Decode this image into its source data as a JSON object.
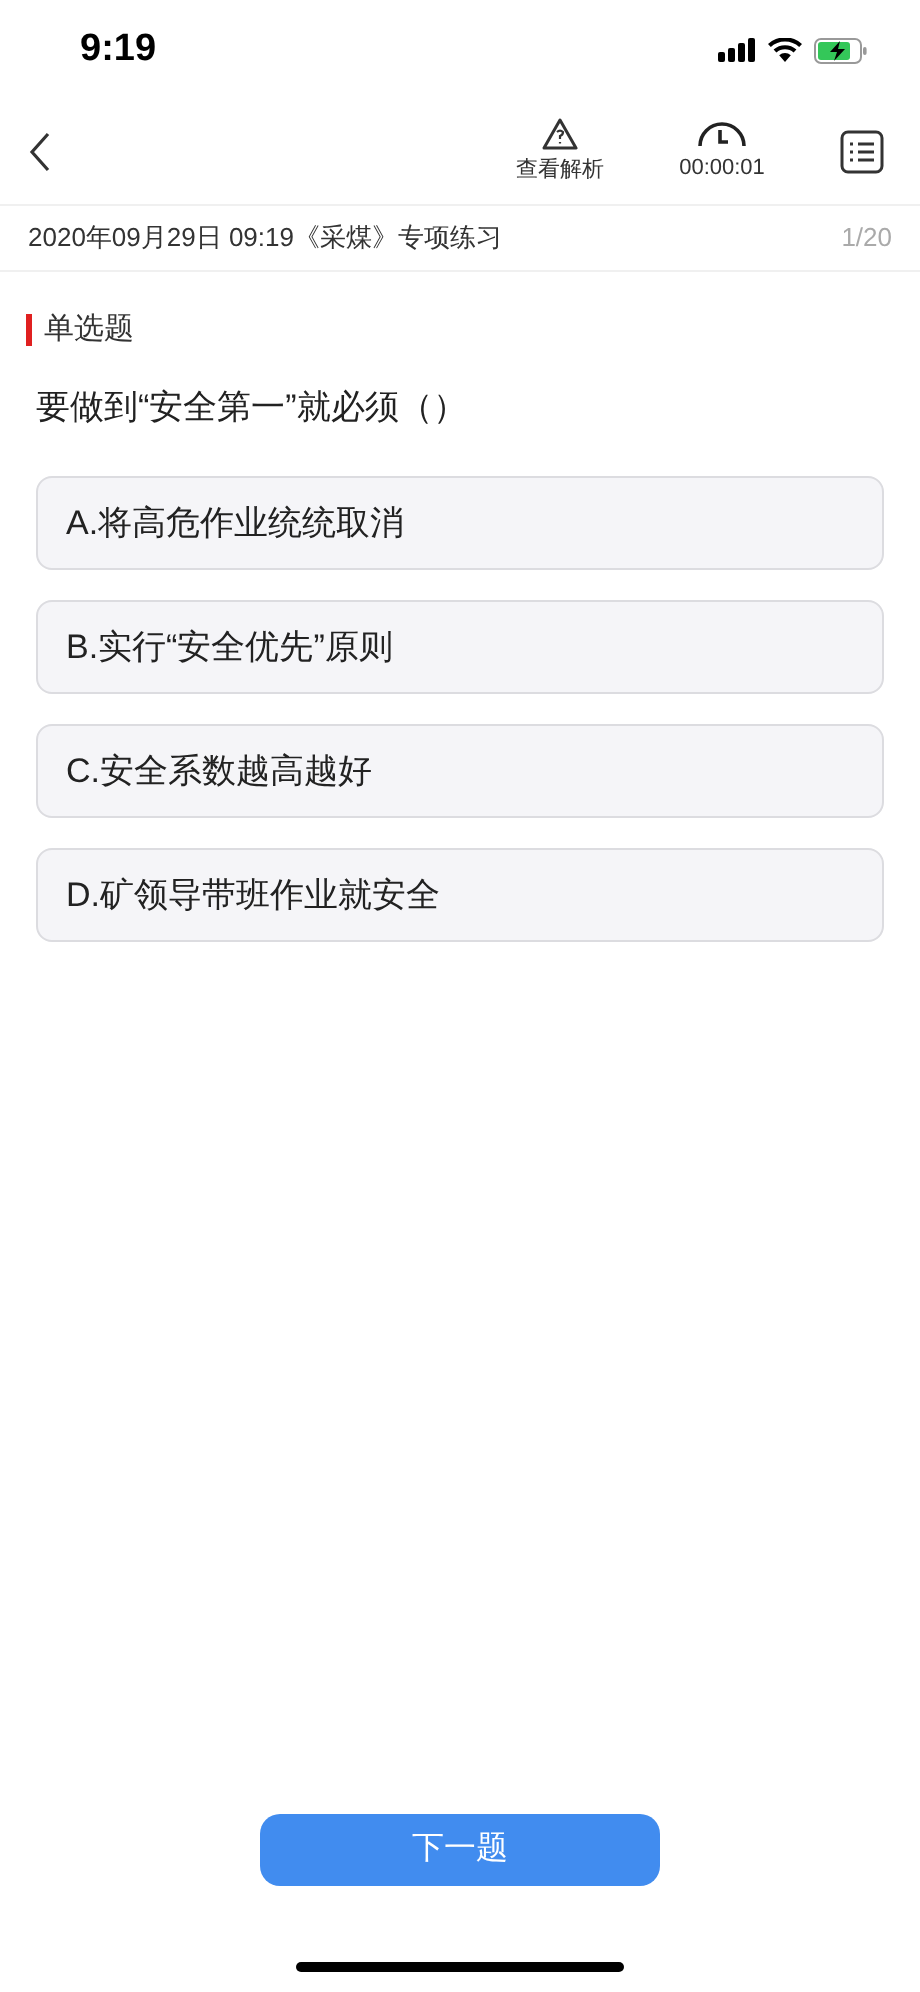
{
  "status_bar": {
    "time": "9:19"
  },
  "nav": {
    "analysis_label": "查看解析",
    "timer": "00:00:01"
  },
  "header": {
    "title": "2020年09月29日 09:19《采煤》专项练习",
    "progress": "1/20"
  },
  "question": {
    "type": "单选题",
    "text": "要做到“安全第一”就必须（）",
    "options": [
      {
        "label": "A.将高危作业统统取消",
        "selected": false
      },
      {
        "label": "B.实行“安全优先”原则",
        "selected": false
      },
      {
        "label": "C.安全系数越高越好",
        "selected": false
      },
      {
        "label": "D.矿领导带班作业就安全",
        "selected": false
      }
    ]
  },
  "next_button": "下一题"
}
